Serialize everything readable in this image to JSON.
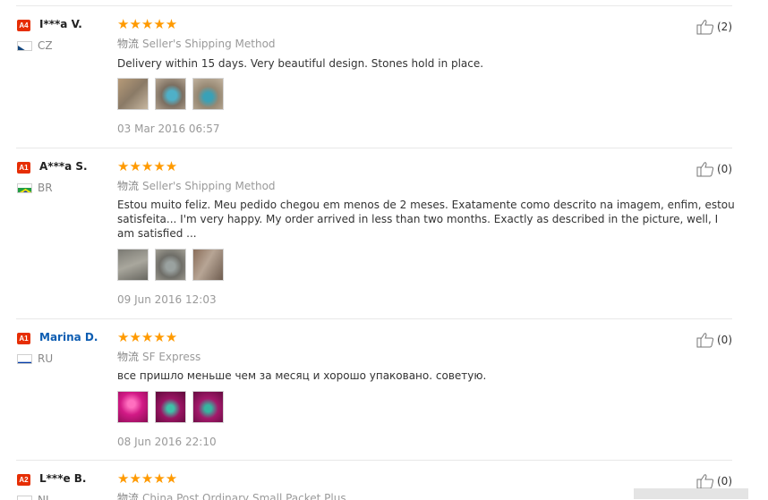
{
  "colors": {
    "accent_badge": "#e62e04",
    "stars": "#ff9a00",
    "link": "#0d5db2"
  },
  "shipping_prefix": "物流",
  "reviews": [
    {
      "badge": "A4",
      "name": "I***a V.",
      "country": "CZ",
      "flag_icon": "czech-flag-icon",
      "stars": "★★★★★",
      "rating": 5,
      "shipping": "Seller's Shipping Method",
      "text": "Delivery within 15 days. Very beautiful design. Stones hold in place.",
      "date": "03 Mar 2016 06:57",
      "helpful": "(2)"
    },
    {
      "badge": "A1",
      "name": "A***a S.",
      "country": "BR",
      "flag_icon": "brazil-flag-icon",
      "stars": "★★★★★",
      "rating": 5,
      "shipping": "Seller's Shipping Method",
      "text": "Estou muito feliz. Meu pedido chegou em menos de 2 meses. Exatamente como descrito na imagem, enfim, estou satisfeita... I'm very happy. My order arrived in less than two months. Exactly as described in the picture, well, I am satisfied ...",
      "date": "09 Jun 2016 12:03",
      "helpful": "(0)"
    },
    {
      "badge": "A1",
      "name": "Marina D.",
      "country": "RU",
      "flag_icon": "russia-flag-icon",
      "stars": "★★★★★",
      "rating": 5,
      "shipping": "SF Express",
      "text": "все пришло меньше чем за месяц и хорошо упаковано. советую.",
      "date": "08 Jun 2016 22:10",
      "helpful": "(0)"
    },
    {
      "badge": "A2",
      "name": "L***e B.",
      "country": "NL",
      "flag_icon": "netherlands-flag-icon",
      "stars": "★★★★★",
      "rating": 5,
      "shipping": "China Post Ordinary Small Packet Plus",
      "helpful": "(0)"
    }
  ]
}
